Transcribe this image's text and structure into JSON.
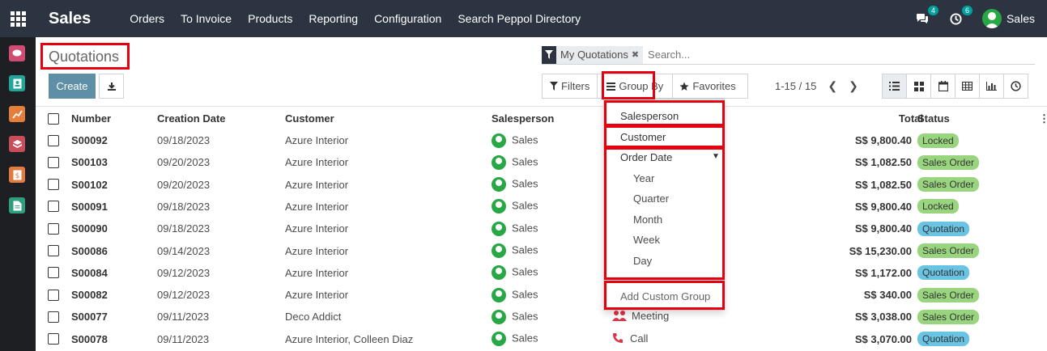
{
  "navbar": {
    "app_name": "Sales",
    "menu": [
      "Orders",
      "To Invoice",
      "Products",
      "Reporting",
      "Configuration",
      "Search Peppol Directory"
    ],
    "messages_count": "4",
    "activities_count": "6",
    "user_name": "Sales"
  },
  "control_panel": {
    "breadcrumb": "Quotations",
    "create_label": "Create",
    "facet_value": "My Quotations",
    "search_placeholder": "Search...",
    "filters_label": "Filters",
    "groupby_label": "Group By",
    "favorites_label": "Favorites",
    "pager_value": "1-15 / 15"
  },
  "table": {
    "headers": {
      "number": "Number",
      "creation_date": "Creation Date",
      "customer": "Customer",
      "salesperson": "Salesperson",
      "total": "Total",
      "status": "Status"
    },
    "rows": [
      {
        "number": "S00092",
        "date": "09/18/2023",
        "customer": "Azure Interior",
        "salesperson": "Sales",
        "activity": "",
        "total": "S$ 9,800.40",
        "status": "Locked"
      },
      {
        "number": "S00103",
        "date": "09/20/2023",
        "customer": "Azure Interior",
        "salesperson": "Sales",
        "activity": "",
        "total": "S$ 1,082.50",
        "status": "Sales Order"
      },
      {
        "number": "S00102",
        "date": "09/20/2023",
        "customer": "Azure Interior",
        "salesperson": "Sales",
        "activity": "",
        "total": "S$ 1,082.50",
        "status": "Sales Order"
      },
      {
        "number": "S00091",
        "date": "09/18/2023",
        "customer": "Azure Interior",
        "salesperson": "Sales",
        "activity": "",
        "total": "S$ 9,800.40",
        "status": "Locked"
      },
      {
        "number": "S00090",
        "date": "09/18/2023",
        "customer": "Azure Interior",
        "salesperson": "Sales",
        "activity": "",
        "total": "S$ 9,800.40",
        "status": "Quotation"
      },
      {
        "number": "S00086",
        "date": "09/14/2023",
        "customer": "Azure Interior",
        "salesperson": "Sales",
        "activity": "",
        "total": "S$ 15,230.00",
        "status": "Sales Order"
      },
      {
        "number": "S00084",
        "date": "09/12/2023",
        "customer": "Azure Interior",
        "salesperson": "Sales",
        "activity": "",
        "total": "S$ 1,172.00",
        "status": "Quotation"
      },
      {
        "number": "S00082",
        "date": "09/12/2023",
        "customer": "Azure Interior",
        "salesperson": "Sales",
        "activity": "",
        "total": "S$ 340.00",
        "status": "Sales Order"
      },
      {
        "number": "S00077",
        "date": "09/11/2023",
        "customer": "Deco Addict",
        "salesperson": "Sales",
        "activity": "Meeting",
        "total": "S$ 3,038.00",
        "status": "Sales Order"
      },
      {
        "number": "S00078",
        "date": "09/11/2023",
        "customer": "Azure Interior, Colleen Diaz",
        "salesperson": "Sales",
        "activity": "Call",
        "total": "S$ 3,070.00",
        "status": "Quotation"
      }
    ]
  },
  "groupby_dropdown": {
    "salesperson": "Salesperson",
    "customer": "Customer",
    "order_date": "Order Date",
    "year": "Year",
    "quarter": "Quarter",
    "month": "Month",
    "week": "Week",
    "day": "Day",
    "add_custom": "Add Custom Group"
  },
  "colors": {
    "navbar": "#2b3440",
    "primary": "#5f8fa6",
    "highlight": "#e4000f",
    "status_green": "#99d47e",
    "status_blue": "#69c3e2"
  }
}
